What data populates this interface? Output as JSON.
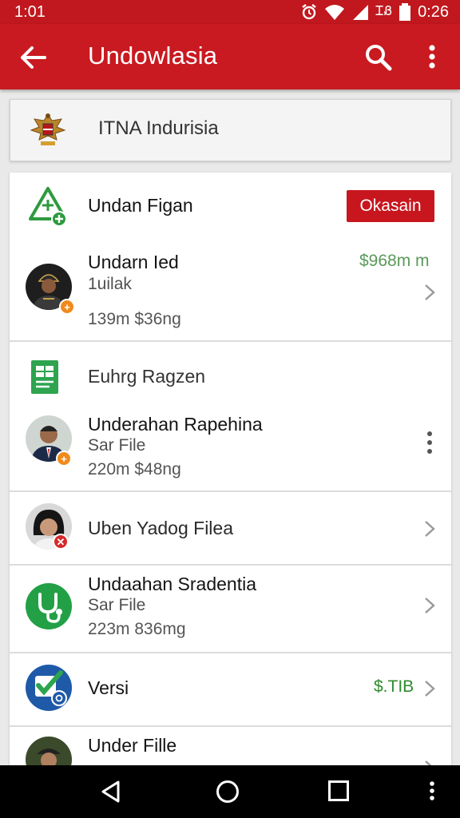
{
  "status_bar": {
    "time_left": "1:01",
    "time_right": "0:26",
    "carrier": "ᏆᏰ"
  },
  "app_bar": {
    "title": "Undowlasia"
  },
  "header": {
    "name": "ITNA Indurisia"
  },
  "list": {
    "items": [
      {
        "title": "Undan Figan",
        "button": "Okasain",
        "icon": "green-triangle-add-icon"
      },
      {
        "title": "Undarn Ied",
        "subtitle": "1uilak",
        "meta": "139m $36ng",
        "price": "$968m m",
        "icon": "person-avatar"
      },
      {
        "title": "Euhrg Ragzen",
        "icon": "green-document-icon"
      },
      {
        "title": "Underahan Rapehina",
        "subtitle": "Sar File",
        "meta": "220m $48ng",
        "icon": "person-avatar"
      },
      {
        "title": "Uben Yadog Filea",
        "icon": "person-avatar"
      },
      {
        "title": "Undaahan Sradentia",
        "subtitle": "Sar File",
        "meta": "223m 836mg",
        "icon": "green-stethoscope-icon"
      },
      {
        "title": "Versi",
        "price": "$.TIB",
        "icon": "blue-checkbox-icon"
      },
      {
        "title": "Under Fille",
        "icon": "person-avatar"
      }
    ]
  },
  "colors": {
    "primary": "#c81a20",
    "accent_green": "#2e8b2e",
    "status_bar": "#c0181e"
  }
}
